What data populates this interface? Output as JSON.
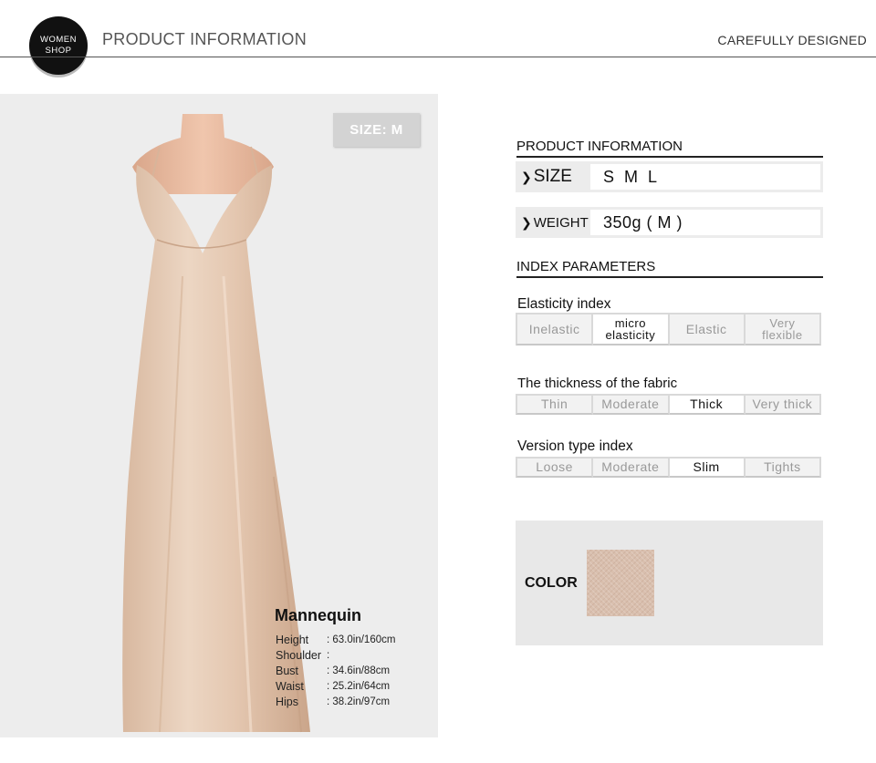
{
  "header": {
    "logo_line1": "WOMEN",
    "logo_line2": "SHOP",
    "title": "PRODUCT INFORMATION",
    "tagline": "CAREFULLY DESIGNED"
  },
  "photo": {
    "size_badge": "SIZE: M",
    "dress_color": "#e3c9b3"
  },
  "mannequin": {
    "title": "Mannequin",
    "rows": [
      {
        "label": "Height",
        "value": ": 63.0in/160cm"
      },
      {
        "label": "Shoulder",
        "value": ":"
      },
      {
        "label": "Bust",
        "value": ": 34.6in/88cm"
      },
      {
        "label": "Waist",
        "value": ": 25.2in/64cm"
      },
      {
        "label": "Hips",
        "value": ": 38.2in/97cm"
      }
    ]
  },
  "product_info": {
    "title": "PRODUCT INFORMATION",
    "size_label": "SIZE",
    "size_value": "S M L",
    "weight_label": "WEIGHT",
    "weight_value": "350g ( M )"
  },
  "index_params": {
    "title": "INDEX PARAMETERS",
    "elasticity": {
      "label": "Elasticity index",
      "options": [
        {
          "line1": "Inelastic",
          "line2": ""
        },
        {
          "line1": "micro",
          "line2": "elasticity"
        },
        {
          "line1": "Elastic",
          "line2": ""
        },
        {
          "line1": "Very",
          "line2": "flexible"
        }
      ],
      "selected": 1
    },
    "thickness": {
      "label": "The thickness of the fabric",
      "options": [
        "Thin",
        "Moderate",
        "Thick",
        "Very thick"
      ],
      "selected": 2
    },
    "version": {
      "label": "Version type index",
      "options": [
        "Loose",
        "Moderate",
        "Slim",
        "Tights"
      ],
      "selected": 2
    }
  },
  "color": {
    "label": "COLOR",
    "swatch": "#d9bfae"
  }
}
